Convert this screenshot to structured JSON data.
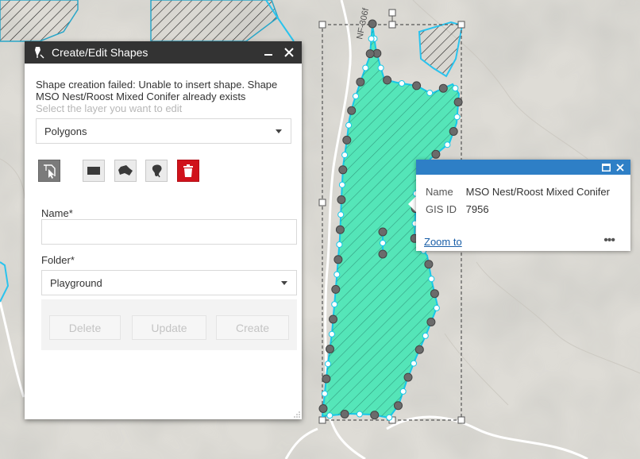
{
  "map": {
    "road_label": "NF-306f",
    "colors": {
      "shape_fill": "#3de8b4",
      "shape_stroke": "#18c8e8",
      "base": "#dedcd6"
    }
  },
  "panel": {
    "title": "Create/Edit Shapes",
    "message": "Shape creation failed: Unable to insert shape. Shape MSO Nest/Roost Mixed Conifer already exists",
    "layer_hint": "Select the layer you want to edit",
    "layer_select": {
      "value": "Polygons"
    },
    "tools": [
      {
        "name": "select-tool",
        "icon": "select-icon"
      },
      {
        "name": "rectangle-tool",
        "icon": "rectangle-icon"
      },
      {
        "name": "polygon-tool",
        "icon": "polygon-icon"
      },
      {
        "name": "freehand-tool",
        "icon": "freehand-icon"
      },
      {
        "name": "delete-tool",
        "icon": "trash-icon"
      }
    ],
    "name_label": "Name",
    "name_value": "",
    "folder_label": "Folder",
    "required_mark": "*",
    "folder_select": {
      "value": "Playground"
    },
    "buttons": {
      "delete": "Delete",
      "update": "Update",
      "create": "Create"
    }
  },
  "popup": {
    "fields": [
      {
        "key": "Name",
        "value": "MSO Nest/Roost Mixed Conifer"
      },
      {
        "key": "GIS ID",
        "value": "7956"
      }
    ],
    "zoom_link": "Zoom to",
    "more": "•••"
  }
}
